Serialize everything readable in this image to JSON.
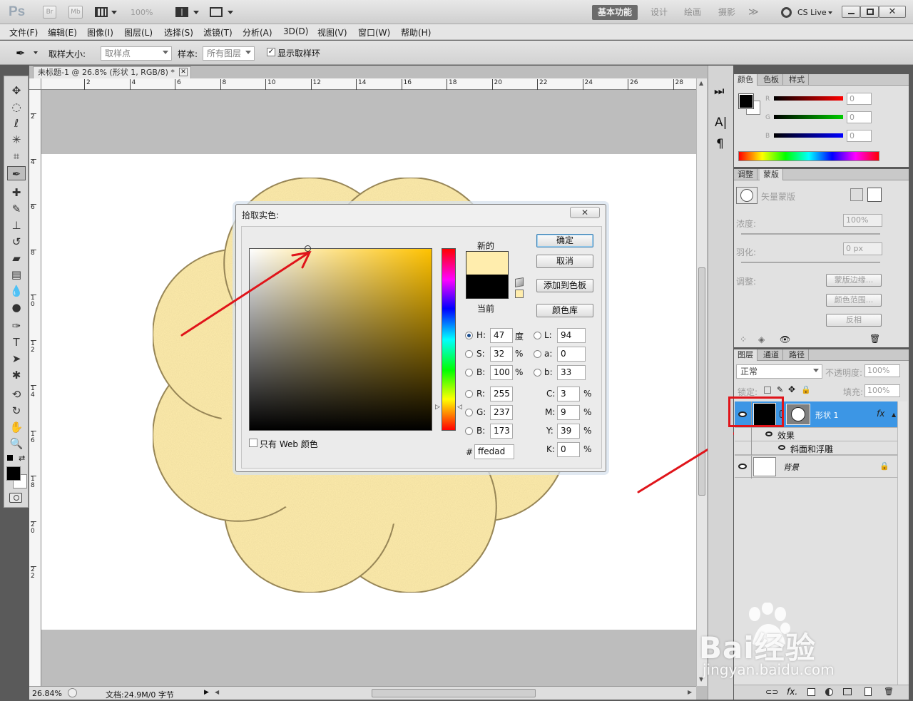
{
  "appbar": {
    "logo": "Ps",
    "br": "Br",
    "mb": "Mb",
    "zoom": "100%",
    "workspaces": [
      "基本功能",
      "设计",
      "绘画",
      "摄影"
    ],
    "more": "≫",
    "cslive": "CS Live"
  },
  "menu": [
    "文件(F)",
    "编辑(E)",
    "图像(I)",
    "图层(L)",
    "选择(S)",
    "滤镜(T)",
    "分析(A)",
    "3D(D)",
    "视图(V)",
    "窗口(W)",
    "帮助(H)"
  ],
  "options": {
    "sample_size_label": "取样大小:",
    "sample_size_value": "取样点",
    "sample_label": "样本:",
    "sample_value": "所有图层",
    "show_ring_label": "显示取样环"
  },
  "document": {
    "tab_title": "未标题-1 @ 26.8% (形状 1, RGB/8) *",
    "ruler_h": [
      "2",
      "4",
      "6",
      "8",
      "10",
      "12",
      "14",
      "16",
      "18",
      "20",
      "22",
      "24",
      "26",
      "28"
    ],
    "ruler_v": [
      "2",
      "4",
      "6",
      "8",
      "10",
      "12",
      "14",
      "16",
      "18",
      "20",
      "22"
    ],
    "shape_color": "#ffedad"
  },
  "status": {
    "zoom": "26.84%",
    "doc_info": "文档:24.9M/0 字节"
  },
  "dialog": {
    "title": "拾取实色:",
    "new_label": "新的",
    "current_label": "当前",
    "new_color": "#ffedad",
    "current_color": "#000000",
    "buttons": {
      "ok": "确定",
      "cancel": "取消",
      "add_swatch": "添加到色板",
      "libraries": "颜色库"
    },
    "hsb": {
      "h_label": "H:",
      "h": "47",
      "h_unit": "度",
      "s_label": "S:",
      "s": "32",
      "s_unit": "%",
      "b_label": "B:",
      "b": "100",
      "b_unit": "%"
    },
    "lab": {
      "l_label": "L:",
      "l": "94",
      "a_label": "a:",
      "a": "0",
      "b_label": "b:",
      "b": "33"
    },
    "rgb": {
      "r_label": "R:",
      "r": "255",
      "g_label": "G:",
      "g": "237",
      "b_label": "B:",
      "b": "173"
    },
    "cmyk": {
      "c_label": "C:",
      "c": "3",
      "m_label": "M:",
      "m": "9",
      "y_label": "Y:",
      "y": "39",
      "k_label": "K:",
      "k": "0",
      "unit": "%"
    },
    "hex_label": "#",
    "hex": "ffedad",
    "web_only": "只有 Web 颜色"
  },
  "color_panel": {
    "tabs": [
      "颜色",
      "色板",
      "样式"
    ],
    "r_label": "R",
    "g_label": "G",
    "b_label": "B",
    "r": "0",
    "g": "0",
    "b": "0"
  },
  "masks_panel": {
    "tabs": [
      "调整",
      "蒙版"
    ],
    "vector_mask": "矢量蒙版",
    "density_label": "浓度:",
    "density": "100%",
    "feather_label": "羽化:",
    "feather": "0 px",
    "refine_label": "调整:",
    "mask_edge": "蒙版边缘...",
    "color_range": "颜色范围...",
    "invert": "反相"
  },
  "layers_panel": {
    "tabs": [
      "图层",
      "通道",
      "路径"
    ],
    "blend_mode": "正常",
    "opacity_label": "不透明度:",
    "opacity": "100%",
    "lock_label": "锁定:",
    "fill_label": "填充:",
    "fill": "100%",
    "layers": [
      {
        "name": "形状 1",
        "fx": "fx"
      },
      {
        "name": "效果"
      },
      {
        "name": "斜面和浮雕"
      },
      {
        "name": "背景"
      }
    ]
  },
  "watermark": {
    "brand": "Bai经验",
    "url": "jingyan.baidu.com"
  }
}
